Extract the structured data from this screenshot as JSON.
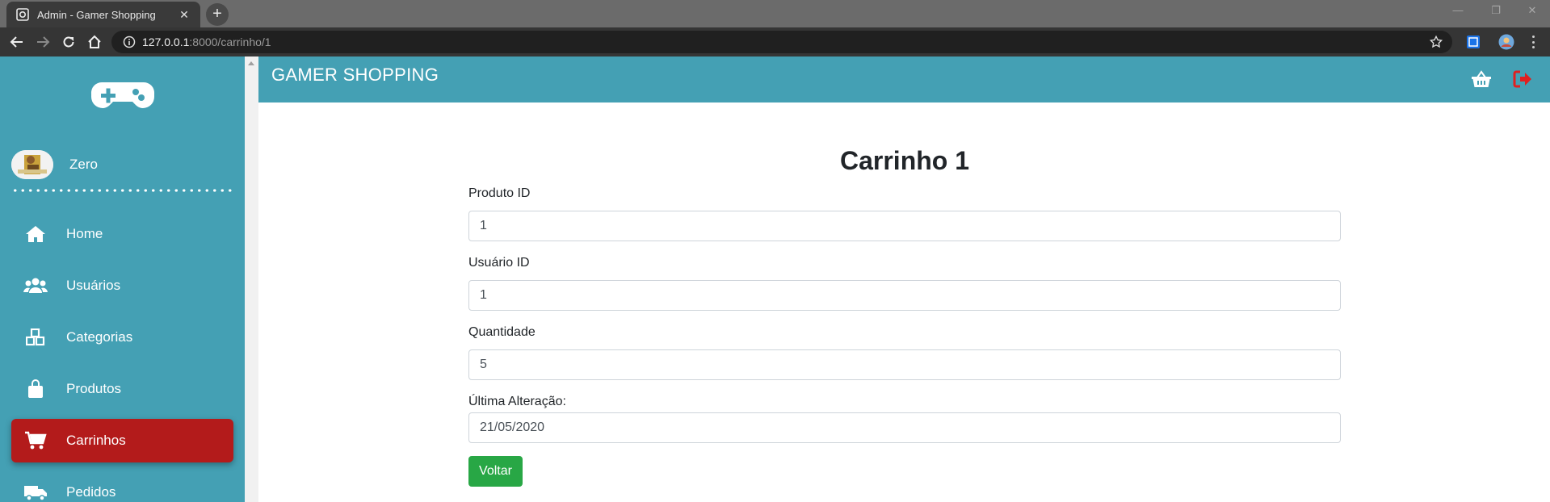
{
  "browser": {
    "tab_title": "Admin - Gamer Shopping",
    "tab_close": "✕",
    "new_tab": "+",
    "url_host": "127.0.0.1",
    "url_rest": ":8000/carrinho/1",
    "window_controls": [
      "—",
      "❐",
      "✕"
    ]
  },
  "sidebar": {
    "logo_icon": "gamepad-icon",
    "user_name": "Zero",
    "items": [
      {
        "label": "Home",
        "icon": "home-icon",
        "active": false
      },
      {
        "label": "Usuários",
        "icon": "users-icon",
        "active": false
      },
      {
        "label": "Categorias",
        "icon": "cubes-icon",
        "active": false
      },
      {
        "label": "Produtos",
        "icon": "shopping-bag-icon",
        "active": false
      },
      {
        "label": "Carrinhos",
        "icon": "cart-icon",
        "active": true
      },
      {
        "label": "Pedidos",
        "icon": "truck-icon",
        "active": false
      }
    ]
  },
  "header": {
    "brand": "GAMER SHOPPING",
    "icons": [
      "basket-icon",
      "logout-icon"
    ]
  },
  "main": {
    "title": "Carrinho 1",
    "fields": [
      {
        "label": "Produto ID",
        "value": "1"
      },
      {
        "label": "Usuário ID",
        "value": "1"
      },
      {
        "label": "Quantidade",
        "value": "5"
      },
      {
        "label": "Última Alteração:",
        "value": "21/05/2020"
      }
    ],
    "back_button": "Voltar"
  },
  "colors": {
    "teal": "#44a0b4",
    "active_red": "#b31b1b",
    "button_green": "#28a745",
    "logout_red": "#e02020"
  }
}
